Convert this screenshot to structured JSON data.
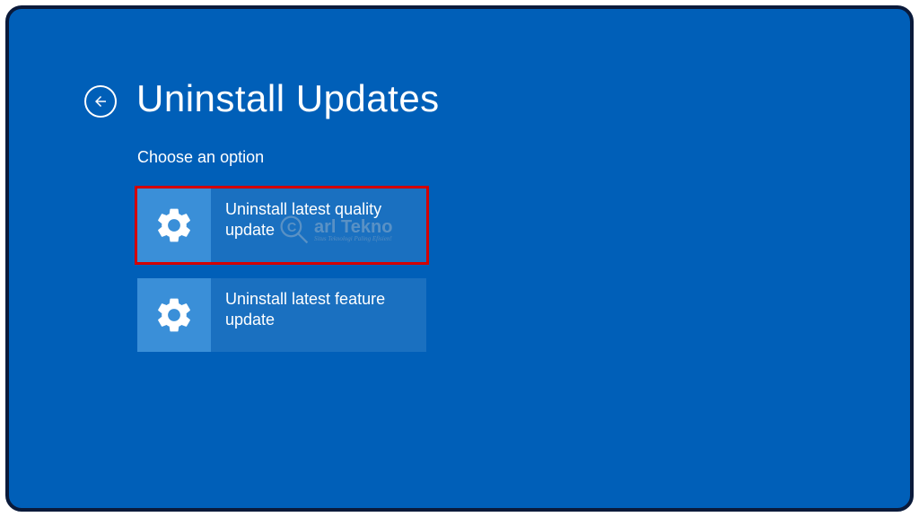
{
  "header": {
    "title": "Uninstall Updates",
    "subtitle": "Choose an option"
  },
  "options": [
    {
      "label": "Uninstall latest quality update",
      "highlighted": true
    },
    {
      "label": "Uninstall latest feature update",
      "highlighted": false
    }
  ],
  "watermark": {
    "main": "arl Tekno",
    "sub": "Situs Teknologi Paling Efisien!"
  },
  "colors": {
    "background": "#005fb8",
    "tile": "#1a70c0",
    "tileIcon": "#3a8fd8",
    "highlight": "#d40000",
    "border": "#0a1a3a"
  }
}
